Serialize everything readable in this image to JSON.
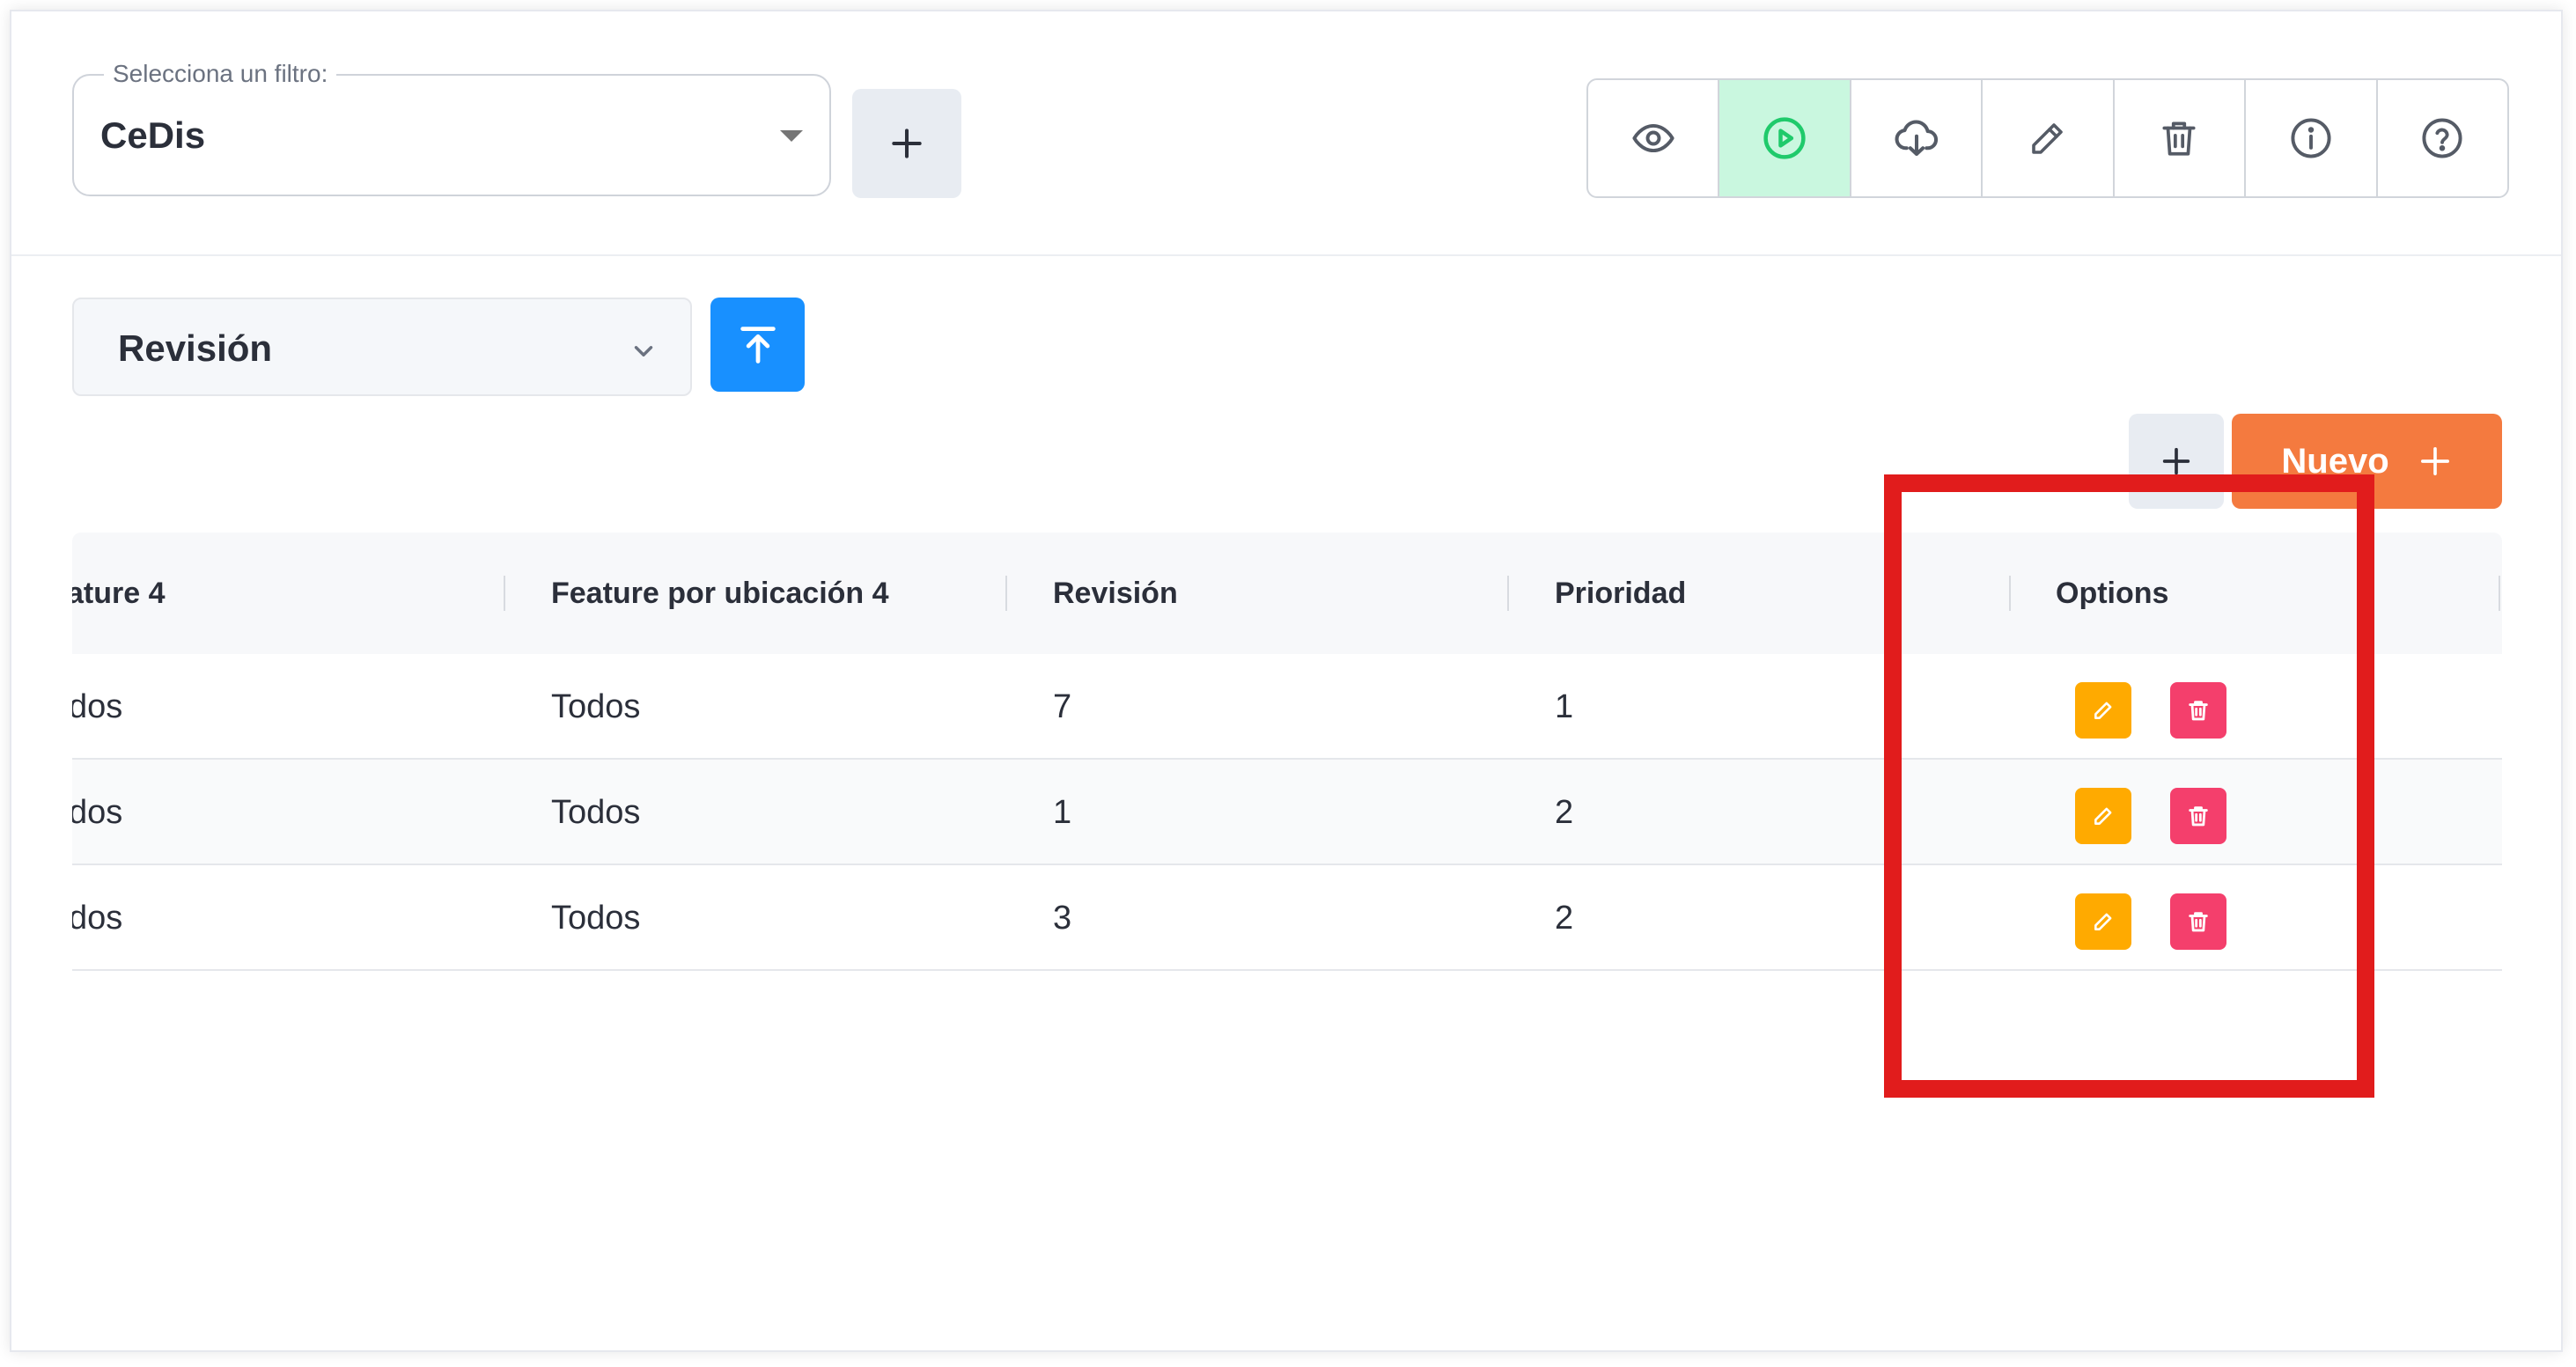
{
  "filter": {
    "legend": "Selecciona un filtro:",
    "value": "CeDis"
  },
  "toolbar": {
    "actions": [
      {
        "icon": "eye-icon",
        "active": false
      },
      {
        "icon": "play-circle-icon",
        "active": true
      },
      {
        "icon": "cloud-download-icon",
        "active": false
      },
      {
        "icon": "pencil-icon",
        "active": false
      },
      {
        "icon": "trash-icon",
        "active": false
      },
      {
        "icon": "info-icon",
        "active": false
      },
      {
        "icon": "help-icon",
        "active": false
      }
    ]
  },
  "view_select": {
    "value": "Revisión"
  },
  "buttons": {
    "new_label": "Nuevo"
  },
  "table": {
    "columns": [
      "ature 4",
      "Feature por ubicación 4",
      "Revisión",
      "Prioridad",
      "Options"
    ],
    "rows": [
      [
        "dos",
        "Todos",
        "7",
        "1"
      ],
      [
        "dos",
        "Todos",
        "1",
        "2"
      ],
      [
        "dos",
        "Todos",
        "3",
        "2"
      ]
    ]
  },
  "colors": {
    "accent_blue": "#1890ff",
    "new_orange": "#f47a3f",
    "active_green": "#c9f7df",
    "icon_green": "#1fca6b",
    "edit_yellow": "#ffaa00",
    "delete_pink": "#f43f6c",
    "highlight_red": "#e11c1c"
  }
}
